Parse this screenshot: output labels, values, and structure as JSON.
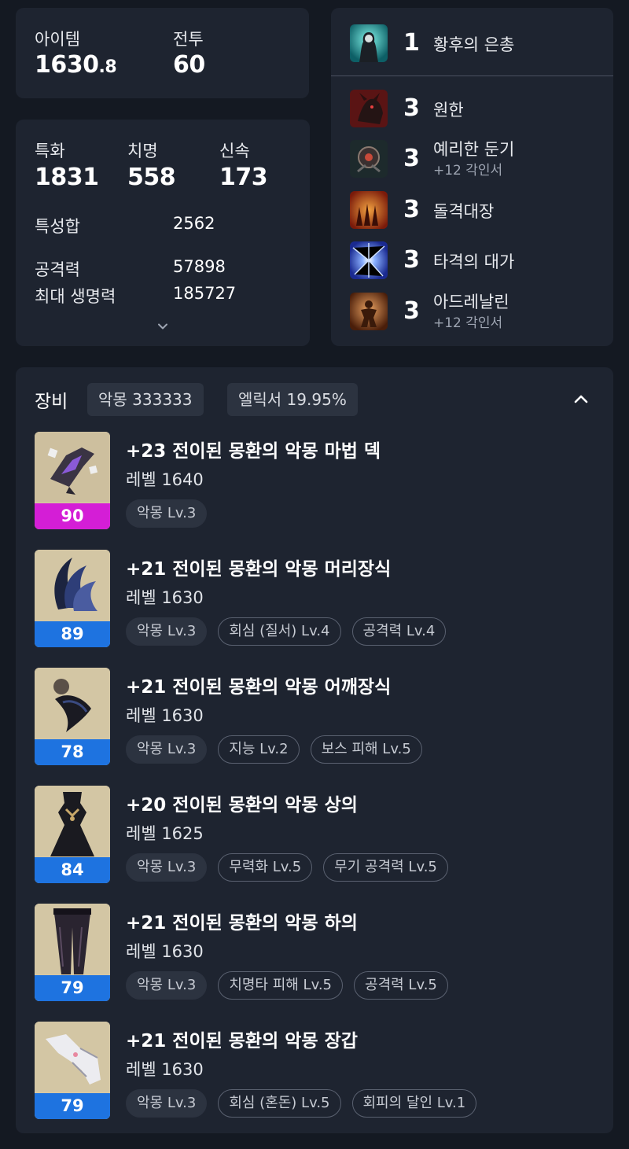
{
  "summary": {
    "item_level_label": "아이템",
    "item_level_int": "1630",
    "item_level_dec": ".8",
    "combat_label": "전투",
    "combat_value": "60"
  },
  "stats": {
    "primary": [
      {
        "label": "특화",
        "value": "1831"
      },
      {
        "label": "치명",
        "value": "558"
      },
      {
        "label": "신속",
        "value": "173"
      }
    ],
    "total_label": "특성합",
    "total_value": "2562",
    "attack_label": "공격력",
    "attack_value": "57898",
    "hp_label": "최대 생명력",
    "hp_value": "185727",
    "expand_icon": "chevron-down-icon"
  },
  "engravings": [
    {
      "level": "1",
      "name": "황후의 은총",
      "sub": "",
      "icon": "empress-grace-icon",
      "color": "#1fa7a0"
    },
    {
      "level": "3",
      "name": "원한",
      "sub": "",
      "icon": "grudge-icon",
      "color": "#7a1e1e"
    },
    {
      "level": "3",
      "name": "예리한 둔기",
      "sub": "+12 각인서",
      "icon": "keen-blunt-weapon-icon",
      "color": "#2a3a3a"
    },
    {
      "level": "3",
      "name": "돌격대장",
      "sub": "",
      "icon": "raid-captain-icon",
      "color": "#b5421a"
    },
    {
      "level": "3",
      "name": "타격의 대가",
      "sub": "",
      "icon": "master-of-strikes-icon",
      "color": "#3048c8"
    },
    {
      "level": "3",
      "name": "아드레날린",
      "sub": "+12 각인서",
      "icon": "adrenaline-icon",
      "color": "#a8541e"
    }
  ],
  "equipment": {
    "title": "장비",
    "chips": [
      "악몽 333333",
      "엘릭서 19.95%"
    ],
    "collapse_icon": "chevron-up-icon",
    "items": [
      {
        "name": "+23 전이된 몽환의 악몽 마법 덱",
        "level": "레벨 1640",
        "quality": "90",
        "quality_color": "#d41ed6",
        "icon": "magic-deck-icon",
        "tags": [
          {
            "text": "악몽 Lv.3",
            "style": "fill"
          }
        ]
      },
      {
        "name": "+21 전이된 몽환의 악몽 머리장식",
        "level": "레벨 1630",
        "quality": "89",
        "quality_color": "#1e73e0",
        "icon": "headgear-icon",
        "tags": [
          {
            "text": "악몽 Lv.3",
            "style": "fill"
          },
          {
            "text": "회심 (질서) Lv.4",
            "style": "outline"
          },
          {
            "text": "공격력 Lv.4",
            "style": "outline"
          }
        ]
      },
      {
        "name": "+21 전이된 몽환의 악몽 어깨장식",
        "level": "레벨 1630",
        "quality": "78",
        "quality_color": "#1e73e0",
        "icon": "shoulder-icon",
        "tags": [
          {
            "text": "악몽 Lv.3",
            "style": "fill"
          },
          {
            "text": "지능 Lv.2",
            "style": "outline"
          },
          {
            "text": "보스 피해 Lv.5",
            "style": "outline"
          }
        ]
      },
      {
        "name": "+20 전이된 몽환의 악몽 상의",
        "level": "레벨 1625",
        "quality": "84",
        "quality_color": "#1e73e0",
        "icon": "chest-armor-icon",
        "tags": [
          {
            "text": "악몽 Lv.3",
            "style": "fill"
          },
          {
            "text": "무력화 Lv.5",
            "style": "outline"
          },
          {
            "text": "무기 공격력 Lv.5",
            "style": "outline"
          }
        ]
      },
      {
        "name": "+21 전이된 몽환의 악몽 하의",
        "level": "레벨 1630",
        "quality": "79",
        "quality_color": "#1e73e0",
        "icon": "pants-icon",
        "tags": [
          {
            "text": "악몽 Lv.3",
            "style": "fill"
          },
          {
            "text": "치명타 피해 Lv.5",
            "style": "outline"
          },
          {
            "text": "공격력 Lv.5",
            "style": "outline"
          }
        ]
      },
      {
        "name": "+21 전이된 몽환의 악몽 장갑",
        "level": "레벨 1630",
        "quality": "79",
        "quality_color": "#1e73e0",
        "icon": "gloves-icon",
        "tags": [
          {
            "text": "악몽 Lv.3",
            "style": "fill"
          },
          {
            "text": "회심 (혼돈) Lv.5",
            "style": "outline"
          },
          {
            "text": "회피의 달인 Lv.1",
            "style": "outline"
          }
        ]
      }
    ]
  }
}
